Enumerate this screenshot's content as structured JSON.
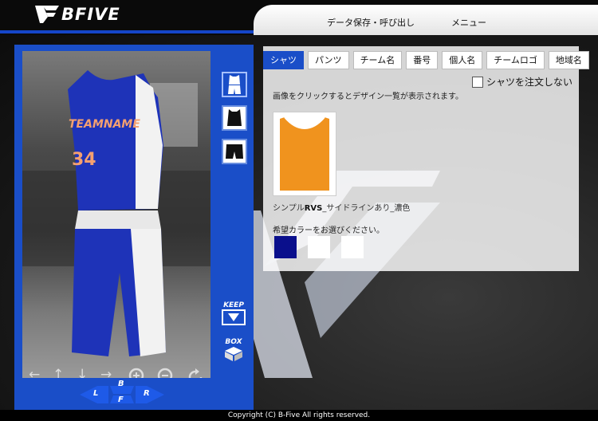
{
  "header": {
    "logo_text": "BFIVE",
    "nav": {
      "save_load": "データ保存・呼び出し",
      "menu": "メニュー"
    }
  },
  "viewer": {
    "jersey": {
      "team_name": "TEAMNAME",
      "number": "34",
      "primary_color": "#1e33b8",
      "side_color": "#f2f2f2",
      "text_color": "#f4a070"
    },
    "controls": {
      "left": "←",
      "up": "↑",
      "down": "↓",
      "right": "→"
    },
    "keep_label": "KEEP",
    "box_label": "BOX",
    "direction": {
      "b": "B",
      "f": "F",
      "l": "L",
      "r": "R"
    }
  },
  "tabs": [
    {
      "label": "シャツ",
      "active": true
    },
    {
      "label": "パンツ",
      "active": false
    },
    {
      "label": "チーム名",
      "active": false
    },
    {
      "label": "番号",
      "active": false
    },
    {
      "label": "個人名",
      "active": false
    },
    {
      "label": "チームロゴ",
      "active": false
    },
    {
      "label": "地域名",
      "active": false
    }
  ],
  "shirt_panel": {
    "no_order_label": "シャツを注文しない",
    "no_order_checked": false,
    "info": "画像をクリックするとデザイン一覧が表示されます。",
    "design_name_prefix": "シンプル",
    "design_name_bold": "RVS",
    "design_name_suffix": "_サイドラインあり_濃色",
    "color_prompt": "希望カラーをお選びください。",
    "thumbnail_color": "#f0931e",
    "swatches": [
      {
        "name": "navy",
        "color": "#0a0f8c"
      },
      {
        "name": "white",
        "color": "#ffffff"
      },
      {
        "name": "white",
        "color": "#ffffff"
      }
    ]
  },
  "footer": {
    "copyright": "Copyright (C) B-Five All rights reserved."
  }
}
